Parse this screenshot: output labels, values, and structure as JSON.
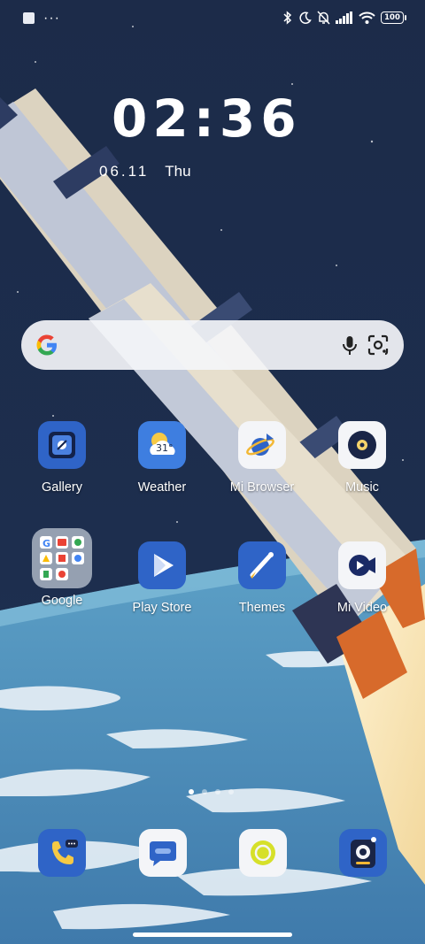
{
  "status_bar": {
    "battery_level": "100",
    "left_indicator": "···",
    "icons": [
      "app-notification-icon",
      "more-dots-icon",
      "bluetooth-icon",
      "moon-icon",
      "bell-off-icon",
      "signal-icon",
      "wifi-icon",
      "battery-icon"
    ]
  },
  "clock": {
    "time": "02:36",
    "date": "06.11",
    "weekday": "Thu"
  },
  "search": {
    "icons": [
      "google-logo-icon",
      "microphone-icon",
      "lens-icon"
    ]
  },
  "apps": [
    {
      "label": "Gallery",
      "icon": "gallery-icon"
    },
    {
      "label": "Weather",
      "icon": "weather-icon",
      "badge": "31°"
    },
    {
      "label": "Mi Browser",
      "icon": "browser-icon"
    },
    {
      "label": "Music",
      "icon": "music-icon"
    },
    {
      "label": "Google",
      "icon": "google-folder-icon"
    },
    {
      "label": "Play Store",
      "icon": "play-store-icon"
    },
    {
      "label": "Themes",
      "icon": "themes-icon"
    },
    {
      "label": "Mi Video",
      "icon": "video-icon"
    }
  ],
  "pager": {
    "pages": 4,
    "current": 1
  },
  "dock": [
    {
      "icon": "phone-icon"
    },
    {
      "icon": "messages-icon"
    },
    {
      "icon": "camera-icon"
    },
    {
      "icon": "security-icon"
    }
  ],
  "colors": {
    "sky": "#1b2a47",
    "earth": "#4f86b4",
    "accent_blue": "#2f64c7"
  }
}
